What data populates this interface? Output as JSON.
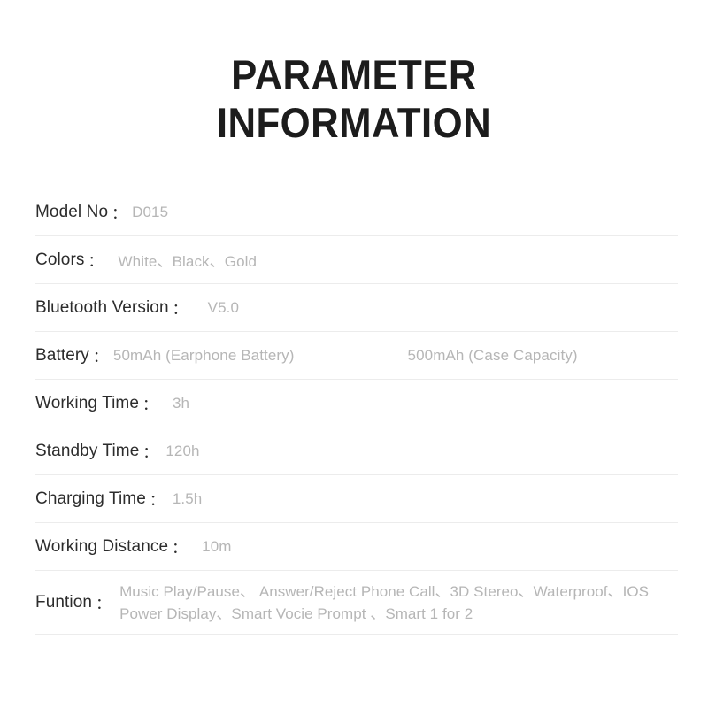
{
  "title": {
    "line1": "PARAMETER",
    "line2": "INFORMATION"
  },
  "colors": {
    "label_text": "#2c2c2c",
    "value_text": "#b6b6b6",
    "title_text": "#1c1c1c",
    "divider": "#ececec",
    "background": "#ffffff"
  },
  "colon": "：",
  "spec_rows": [
    {
      "label": "Model No",
      "value": "D015"
    },
    {
      "label": "Colors",
      "value": "White、Black、Gold"
    },
    {
      "label": "Bluetooth Version",
      "value": "V5.0"
    },
    {
      "label": "Battery",
      "value": "50mAh (Earphone Battery)",
      "value2": "500mAh (Case Capacity)"
    },
    {
      "label": "Working Time",
      "value": "3h"
    },
    {
      "label": "Standby Time",
      "value": "120h"
    },
    {
      "label": "Charging Time",
      "value": "1.5h"
    },
    {
      "label": "Working Distance",
      "value": "10m"
    },
    {
      "label": "Funtion",
      "value_line1": "Music Play/Pause、 Answer/Reject Phone Call、3D Stereo、Waterproof、IOS",
      "value_line2": "Power Display、Smart Vocie Prompt 、Smart 1 for 2"
    }
  ]
}
